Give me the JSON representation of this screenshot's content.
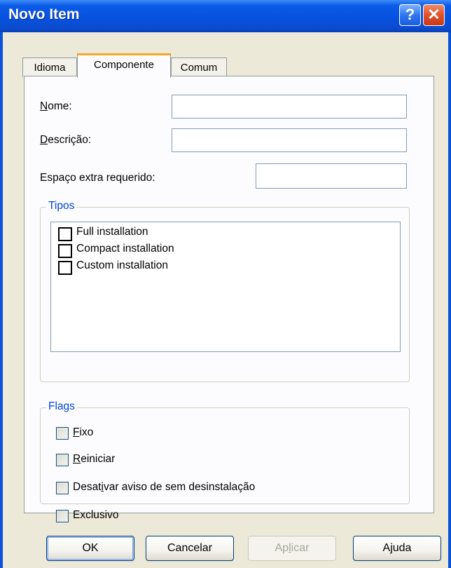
{
  "window": {
    "title": "Novo Item",
    "help_glyph": "?",
    "close_glyph": "✕"
  },
  "tabs": [
    {
      "label": "Idioma"
    },
    {
      "label": "Componente",
      "active": true
    },
    {
      "label": "Comum"
    }
  ],
  "form": {
    "nome_label_u": "N",
    "nome_label_rest": "ome:",
    "nome_value": "",
    "descricao_label_u": "D",
    "descricao_label_rest": "escrição:",
    "descricao_value": "",
    "espaco_label": "Espaço extra requerido:",
    "espaco_value": ""
  },
  "tipos": {
    "label": "Tipos",
    "items": [
      {
        "label": "Full installation",
        "checked": false
      },
      {
        "label": "Compact installation",
        "checked": false
      },
      {
        "label": "Custom installation",
        "checked": false
      }
    ]
  },
  "flags": {
    "label": "Flags",
    "items": [
      {
        "pre": "",
        "u": "F",
        "post": "ixo",
        "checked": false
      },
      {
        "pre": "",
        "u": "R",
        "post": "einiciar",
        "checked": false
      },
      {
        "pre": "Desat",
        "u": "i",
        "post": "var aviso de sem desinstalação",
        "checked": false
      },
      {
        "pre": "Exclusivo",
        "u": "",
        "post": "",
        "checked": false
      }
    ]
  },
  "buttons": {
    "ok": "OK",
    "cancelar": "Cancelar",
    "aplicar_pre": "Ap",
    "aplicar_u": "l",
    "aplicar_post": "icar",
    "ajuda": "Ajuda"
  },
  "colors": {
    "titlebar": "#0a53d6",
    "group_label": "#0046d5",
    "active_tab_accent": "#f5a623"
  }
}
